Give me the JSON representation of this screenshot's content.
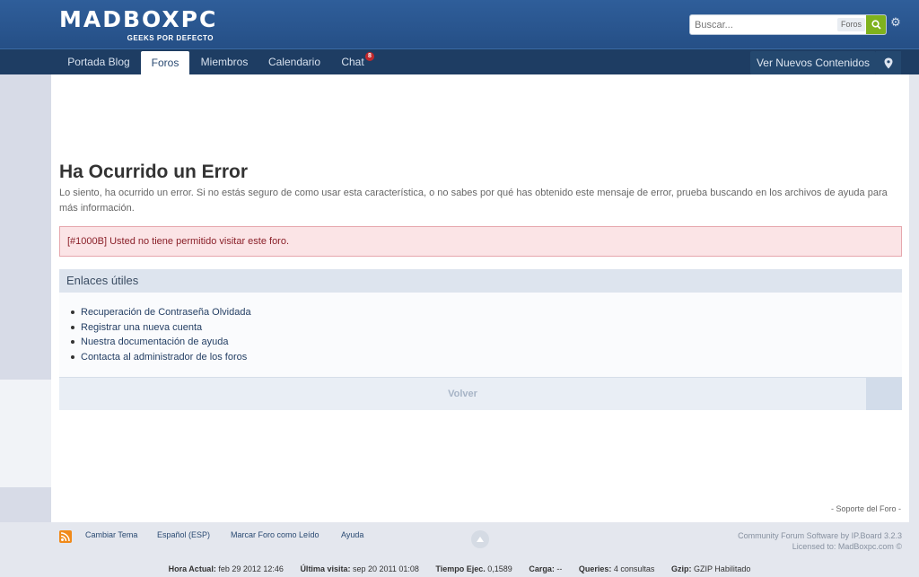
{
  "header": {
    "logo_text": "MADBOXPC",
    "logo_tagline": "GEEKS POR DEFECTO",
    "search_placeholder": "Buscar...",
    "search_scope": "Foros"
  },
  "nav": {
    "items": [
      {
        "label": "Portada Blog"
      },
      {
        "label": "Foros"
      },
      {
        "label": "Miembros"
      },
      {
        "label": "Calendario"
      },
      {
        "label": "Chat"
      }
    ],
    "chat_badge": "8",
    "view_new": "Ver Nuevos Contenidos"
  },
  "error": {
    "title": "Ha Ocurrido un Error",
    "description": "Lo siento, ha ocurrido un error. Si no estás seguro de como usar esta característica, o no sabes por qué has obtenido este mensaje de error, prueba buscando en los archivos de ayuda para más información.",
    "message": "[#1000B] Usted no tiene permitido visitar este foro."
  },
  "links": {
    "heading": "Enlaces útiles",
    "items": [
      {
        "label": "Recuperación de Contraseña Olvidada"
      },
      {
        "label": "Registrar una nueva cuenta"
      },
      {
        "label": "Nuestra documentación de ayuda"
      },
      {
        "label": "Contacta al administrador de los foros"
      }
    ]
  },
  "volver_label": "Volver",
  "support_link": "- Soporte del Foro -",
  "footer": {
    "links": [
      {
        "label": "Cambiar Tema"
      },
      {
        "label": "Español (ESP)"
      },
      {
        "label": "Marcar Foro como Leído"
      },
      {
        "label": "Ayuda"
      }
    ],
    "copyright_line1": "Community Forum Software by IP.Board 3.2.3",
    "copyright_line2": "Licensed to: MadBoxpc.com ©"
  },
  "stats": [
    {
      "label": "Hora Actual:",
      "value": "feb 29 2012 12:46"
    },
    {
      "label": "Última visita:",
      "value": "sep 20 2011 01:08"
    },
    {
      "label": "Tiempo Ejec.",
      "value": "0,1589"
    },
    {
      "label": "Carga:",
      "value": "--"
    },
    {
      "label": "Queries:",
      "value": "4 consultas"
    },
    {
      "label": "Gzip:",
      "value": "GZIP Habilitado"
    }
  ],
  "colors": {
    "header_bg": "#2f5e9a",
    "nav_bg": "#1e3d63",
    "search_button": "#7fb21d",
    "error_bg": "#fbe4e6",
    "error_border": "#e6a7ad",
    "badge": "#c0282c",
    "rss": "#f08a1a"
  }
}
